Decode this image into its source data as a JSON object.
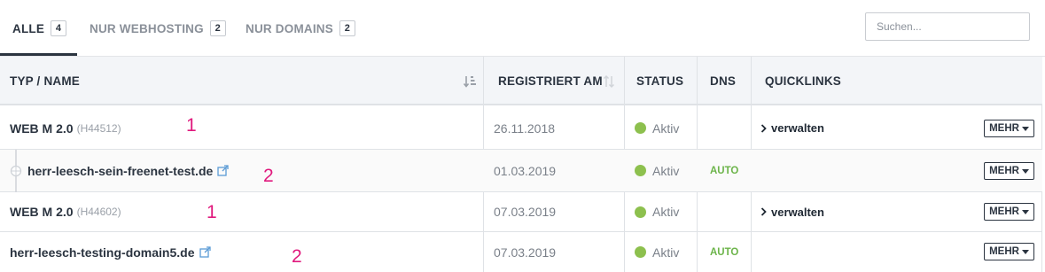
{
  "tabs": [
    {
      "label": "ALLE",
      "count": "4"
    },
    {
      "label": "NUR WEBHOSTING",
      "count": "2"
    },
    {
      "label": "NUR DOMAINS",
      "count": "2"
    }
  ],
  "search": {
    "placeholder": "Suchen..."
  },
  "table": {
    "headers": {
      "typ_name": "TYP / NAME",
      "registriert": "REGISTRIERT AM",
      "status": "STATUS",
      "dns": "DNS",
      "quicklinks": "QUICKLINKS"
    },
    "rows": [
      {
        "name": "WEB M 2.0",
        "id": "(H44512)",
        "date": "26.11.2018",
        "status": "Aktiv",
        "dns": "",
        "quicklink": "verwalten",
        "more": "MEHR",
        "annotation": "1"
      },
      {
        "name": "herr-leesch-sein-freenet-test.de",
        "date": "01.03.2019",
        "status": "Aktiv",
        "dns": "AUTO",
        "more": "MEHR",
        "annotation": "2"
      },
      {
        "name": "WEB M 2.0",
        "id": "(H44602)",
        "date": "07.03.2019",
        "status": "Aktiv",
        "dns": "",
        "quicklink": "verwalten",
        "more": "MEHR",
        "annotation": "1"
      },
      {
        "name": "herr-leesch-testing-domain5.de",
        "date": "07.03.2019",
        "status": "Aktiv",
        "dns": "AUTO",
        "more": "MEHR",
        "annotation": "2"
      }
    ]
  },
  "colors": {
    "status_dot": "#8dc04e",
    "dns_auto": "#6cb44a",
    "annotation": "#e0197d",
    "link_icon": "#5b9bd5"
  },
  "icons": {
    "sort": "sort-ascending-icon",
    "sort_neutral": "sort-neutral-icon",
    "external": "external-link-icon",
    "chevron": "chevron-right-icon",
    "caret": "caret-down-icon",
    "tree": "tree-connector-icon"
  }
}
